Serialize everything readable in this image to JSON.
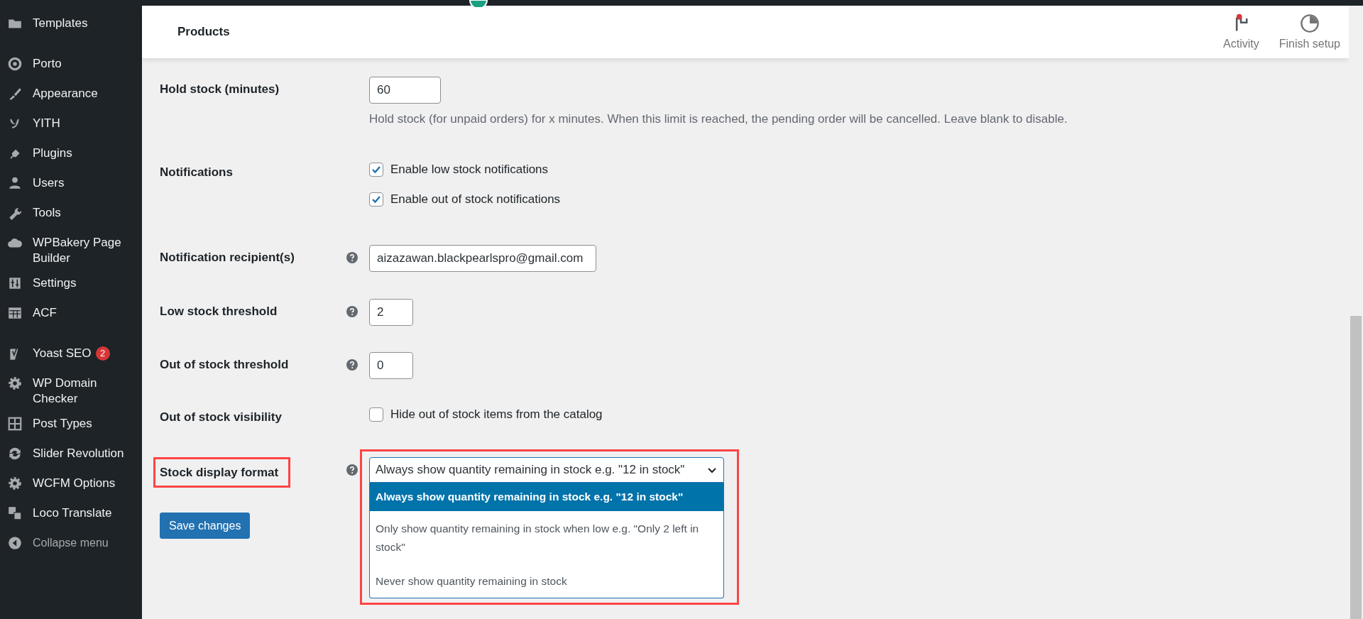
{
  "sidebar": {
    "items": [
      {
        "label": "Templates",
        "group_end": true
      },
      {
        "label": "Porto",
        "group_end": false
      },
      {
        "label": "Appearance",
        "group_end": false
      },
      {
        "label": "YITH",
        "group_end": false
      },
      {
        "label": "Plugins",
        "group_end": false
      },
      {
        "label": "Users",
        "group_end": false
      },
      {
        "label": "Tools",
        "group_end": false
      },
      {
        "label": "WPBakery Page Builder",
        "group_end": false
      },
      {
        "label": "Settings",
        "group_end": false
      },
      {
        "label": "ACF",
        "group_end": true
      },
      {
        "label": "Yoast SEO",
        "badge": "2",
        "group_end": false
      },
      {
        "label": "WP Domain Checker",
        "group_end": false
      },
      {
        "label": "Post Types",
        "group_end": false
      },
      {
        "label": "Slider Revolution",
        "group_end": false
      },
      {
        "label": "WCFM Options",
        "group_end": false
      },
      {
        "label": "Loco Translate",
        "group_end": false
      }
    ],
    "collapse": "Collapse menu"
  },
  "header": {
    "title": "Products",
    "actions": [
      {
        "label": "Activity",
        "has_notification": true
      },
      {
        "label": "Finish setup",
        "has_notification": false
      }
    ]
  },
  "settings": [
    {
      "kind": "text",
      "label": "Hold stock (minutes)",
      "help": false,
      "value": "60",
      "description": "Hold stock (for unpaid orders) for x minutes. When this limit is reached, the pending order will be cancelled. Leave blank to disable."
    },
    {
      "kind": "checkboxes",
      "label": "Notifications",
      "help": false,
      "options": [
        {
          "label": "Enable low stock notifications",
          "checked": true
        },
        {
          "label": "Enable out of stock notifications",
          "checked": true
        }
      ]
    },
    {
      "kind": "text",
      "label": "Notification recipient(s)",
      "help": true,
      "value": "aizazawan.blackpearlspro@gmail.com"
    },
    {
      "kind": "text",
      "label": "Low stock threshold",
      "help": true,
      "value": "2"
    },
    {
      "kind": "text",
      "label": "Out of stock threshold",
      "help": true,
      "value": "0"
    },
    {
      "kind": "checkboxes",
      "label": "Out of stock visibility",
      "help": false,
      "options": [
        {
          "label": "Hide out of stock items from the catalog",
          "checked": false
        }
      ]
    },
    {
      "kind": "select",
      "label": "Stock display format",
      "help": true,
      "highlighted": true,
      "value": "Always show quantity remaining in stock e.g. \"12 in stock\"",
      "expanded": true,
      "options": [
        {
          "label": "Always show quantity remaining in stock e.g. \"12 in stock\"",
          "selected": true
        },
        {
          "label": "Only show quantity remaining in stock when low e.g. \"Only 2 left in stock\"",
          "selected": false
        },
        {
          "label": "Never show quantity remaining in stock",
          "selected": false
        }
      ]
    }
  ],
  "save_button": "Save changes"
}
